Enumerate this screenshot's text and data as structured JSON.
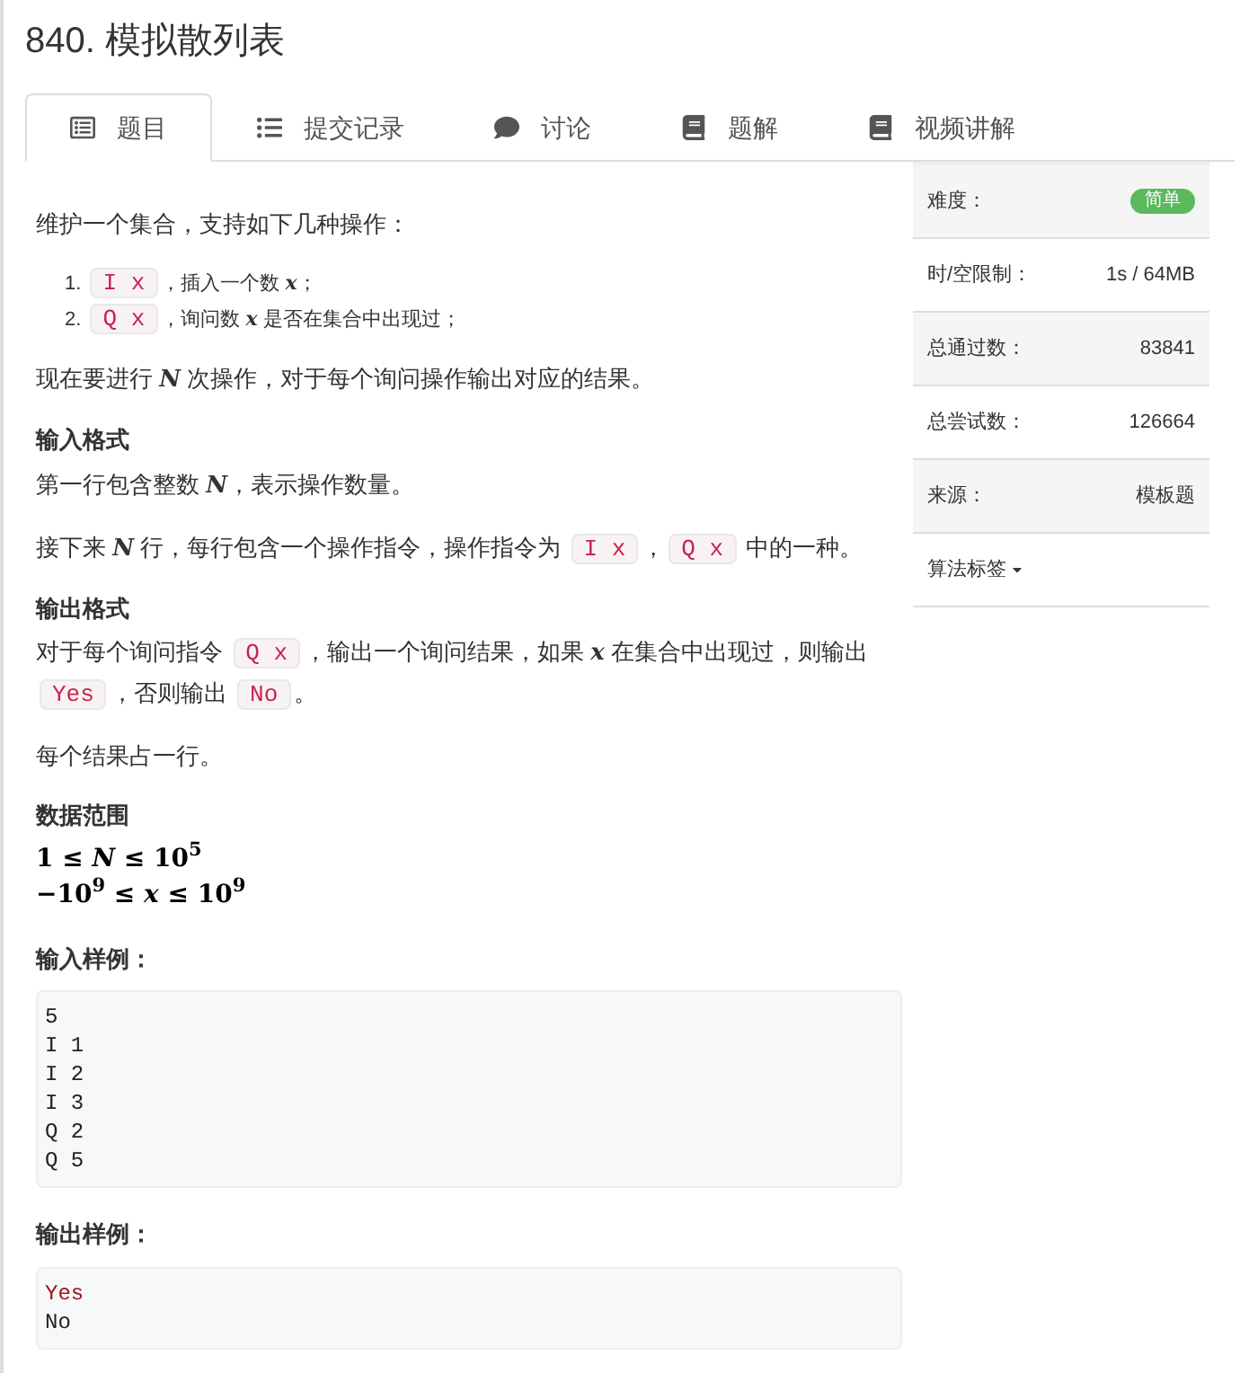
{
  "title": "840. 模拟散列表",
  "tabs": [
    {
      "label": "题目",
      "kind": "problem",
      "selected": true
    },
    {
      "label": "提交记录",
      "kind": "submissions",
      "selected": false
    },
    {
      "label": "讨论",
      "kind": "discussion",
      "selected": false
    },
    {
      "label": "题解",
      "kind": "solutions",
      "selected": false
    },
    {
      "label": "视频讲解",
      "kind": "video",
      "selected": false
    }
  ],
  "blocks": [
    {
      "kind": "para",
      "segments": [
        {
          "kind": "text",
          "text": "维护一个集合，支持如下几种操作："
        }
      ]
    },
    {
      "kind": "list",
      "items": [
        {
          "number": "1.",
          "segments": [
            {
              "kind": "code",
              "text": "I x"
            },
            {
              "kind": "text",
              "text": "，插入一个数 "
            },
            {
              "kind": "math",
              "text": "x"
            },
            {
              "kind": "text",
              "text": "；"
            }
          ]
        },
        {
          "number": "2.",
          "segments": [
            {
              "kind": "code",
              "text": "Q x"
            },
            {
              "kind": "text",
              "text": "，询问数 "
            },
            {
              "kind": "math",
              "text": "x"
            },
            {
              "kind": "text",
              "text": " 是否在集合中出现过；"
            }
          ]
        }
      ]
    },
    {
      "kind": "para",
      "segments": [
        {
          "kind": "text",
          "text": "现在要进行 "
        },
        {
          "kind": "math",
          "text": "N"
        },
        {
          "kind": "text",
          "text": " 次操作，对于每个询问操作输出对应的结果。"
        }
      ]
    },
    {
      "kind": "heading",
      "text": "输入格式"
    },
    {
      "kind": "para",
      "segments": [
        {
          "kind": "text",
          "text": "第一行包含整数 "
        },
        {
          "kind": "math",
          "text": "N"
        },
        {
          "kind": "text",
          "text": "，表示操作数量。"
        }
      ]
    },
    {
      "kind": "para",
      "segments": [
        {
          "kind": "text",
          "text": "接下来 "
        },
        {
          "kind": "math",
          "text": "N"
        },
        {
          "kind": "text",
          "text": " 行，每行包含一个操作指令，操作指令为 "
        },
        {
          "kind": "code",
          "text": "I x"
        },
        {
          "kind": "text",
          "text": "，"
        },
        {
          "kind": "code",
          "text": "Q x"
        },
        {
          "kind": "text",
          "text": " 中的一种。"
        }
      ]
    },
    {
      "kind": "heading",
      "text": "输出格式"
    },
    {
      "kind": "para",
      "segments": [
        {
          "kind": "text",
          "text": "对于每个询问指令 "
        },
        {
          "kind": "code",
          "text": "Q x"
        },
        {
          "kind": "text",
          "text": "，输出一个询问结果，如果 "
        },
        {
          "kind": "math",
          "text": "x"
        },
        {
          "kind": "text",
          "text": " 在集合中出现过，则输出 "
        },
        {
          "kind": "code",
          "text": "Yes"
        },
        {
          "kind": "text",
          "text": "，否则输出 "
        },
        {
          "kind": "code",
          "text": "No"
        },
        {
          "kind": "text",
          "text": "。"
        }
      ]
    },
    {
      "kind": "para",
      "segments": [
        {
          "kind": "text",
          "text": "每个结果占一行。"
        }
      ]
    },
    {
      "kind": "heading",
      "text": "数据范围"
    },
    {
      "kind": "formula",
      "lines": [
        "1 ≤ *N* ≤ 10$^{5}$",
        "−10$^{9}$ ≤ *x* ≤ 10$^{9}$"
      ]
    },
    {
      "kind": "heading",
      "text": "输入样例："
    },
    {
      "kind": "sample",
      "lines": [
        {
          "kind": "plain",
          "text": "5"
        },
        {
          "kind": "plain",
          "text": "I 1"
        },
        {
          "kind": "plain",
          "text": "I 2"
        },
        {
          "kind": "plain",
          "text": "I 3"
        },
        {
          "kind": "plain",
          "text": "Q 2"
        },
        {
          "kind": "plain",
          "text": "Q 5"
        }
      ]
    },
    {
      "kind": "heading",
      "text": "输出样例："
    },
    {
      "kind": "sample",
      "lines": [
        {
          "kind": "keyword",
          "text": "Yes"
        },
        {
          "kind": "plain",
          "text": "No"
        }
      ]
    }
  ],
  "info": [
    {
      "label": "难度：",
      "kind": "badge",
      "value": "简单"
    },
    {
      "label": "时/空限制：",
      "kind": "text",
      "value": "1s / 64MB"
    },
    {
      "label": "总通过数：",
      "kind": "text",
      "value": "83841"
    },
    {
      "label": "总尝试数：",
      "kind": "text",
      "value": "126664"
    },
    {
      "label": "来源：",
      "kind": "text",
      "value": "模板题"
    },
    {
      "label": "算法标签",
      "kind": "dropdown"
    }
  ]
}
